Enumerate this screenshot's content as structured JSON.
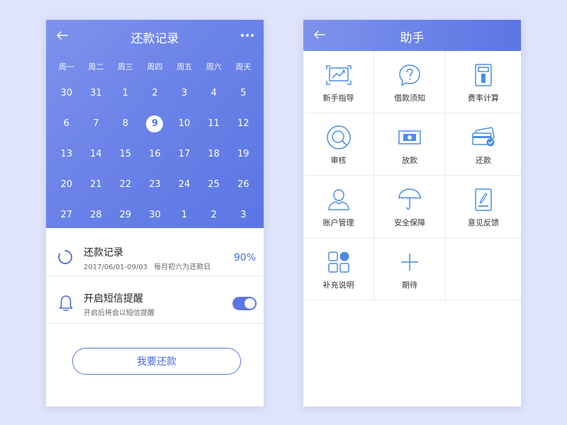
{
  "colors": {
    "primary": "#5b76e4",
    "icon": "#4a8ce8",
    "background": "#dfe3fb"
  },
  "repay": {
    "title": "还款记录",
    "weekdays": [
      "周一",
      "周二",
      "周三",
      "周四",
      "周五",
      "周六",
      "周天"
    ],
    "days": [
      "30",
      "31",
      "1",
      "2",
      "3",
      "4",
      "5",
      "6",
      "7",
      "8",
      "9",
      "10",
      "11",
      "12",
      "13",
      "14",
      "15",
      "16",
      "17",
      "18",
      "19",
      "20",
      "21",
      "22",
      "23",
      "24",
      "25",
      "26",
      "27",
      "28",
      "29",
      "30",
      "1",
      "2",
      "3"
    ],
    "selected_day": "9",
    "record": {
      "title": "还款记录",
      "date_range": "2017/06/01-09/03",
      "note": "每月初六为还款日",
      "percent": "90%"
    },
    "sms": {
      "title": "开启短信提醒",
      "subtitle": "开启后将会以短信提醒",
      "enabled": true
    },
    "button_label": "我要还款"
  },
  "helper": {
    "title": "助手",
    "items": [
      {
        "label": "新手指导",
        "icon": "chart-screen-icon"
      },
      {
        "label": "借款须知",
        "icon": "question-bubble-icon"
      },
      {
        "label": "费率计算",
        "icon": "calculator-icon"
      },
      {
        "label": "审核",
        "icon": "search-circle-icon"
      },
      {
        "label": "放款",
        "icon": "money-icon"
      },
      {
        "label": "还款",
        "icon": "card-check-icon"
      },
      {
        "label": "账户管理",
        "icon": "user-icon"
      },
      {
        "label": "安全保障",
        "icon": "umbrella-icon"
      },
      {
        "label": "意见反馈",
        "icon": "feedback-icon"
      },
      {
        "label": "补充说明",
        "icon": "blocks-icon"
      },
      {
        "label": "期待",
        "icon": "plus-icon"
      }
    ]
  }
}
